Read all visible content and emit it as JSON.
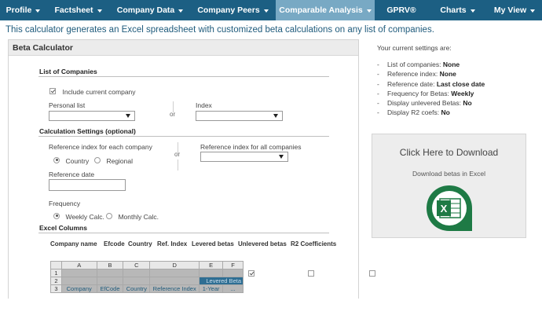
{
  "nav": [
    {
      "label": "Profile",
      "caret": true
    },
    {
      "label": "Factsheet",
      "caret": true
    },
    {
      "label": "Company Data",
      "caret": true
    },
    {
      "label": "Company Peers",
      "caret": true
    },
    {
      "label": "Comparable Analysis",
      "caret": true,
      "active": true
    },
    {
      "label": "GPRV®",
      "caret": false
    },
    {
      "label": "Charts",
      "caret": true
    },
    {
      "label": "My View",
      "caret": true
    }
  ],
  "intro": "This calculator generates an Excel spreadsheet with customized beta calculations on any list of companies.",
  "panel": {
    "title": "Beta Calculator",
    "list_section": "List of Companies",
    "include_current": "Include current company",
    "personal_list": "Personal list",
    "or": "or",
    "index": "Index",
    "calc_section": "Calculation Settings (optional)",
    "ref_each": "Reference index for each company",
    "country": "Country",
    "regional": "Regional",
    "ref_all": "Reference index for all companies",
    "ref_date": "Reference date",
    "frequency": "Frequency",
    "weekly": "Weekly Calc.",
    "monthly": "Monthly Calc.",
    "excel_section": "Excel Columns",
    "columns": [
      {
        "label": "Company name",
        "checked": true
      },
      {
        "label": "Efcode",
        "checked": true
      },
      {
        "label": "Country",
        "checked": true
      },
      {
        "label": "Ref. Index",
        "checked": true
      },
      {
        "label": "Levered betas",
        "checked": true
      },
      {
        "label": "Unlevered betas",
        "checked": false
      },
      {
        "label": "R2 Coefficients",
        "checked": false
      }
    ]
  },
  "excel_preview": {
    "col_letters": [
      "A",
      "B",
      "C",
      "D",
      "E",
      "F"
    ],
    "row_numbers": [
      "1",
      "2",
      "3"
    ],
    "row2_label": "Levered Beta",
    "row3": [
      "Company",
      "EfCode",
      "Country",
      "Reference Index",
      "1-Year",
      "..."
    ]
  },
  "settings": {
    "title": "Your current settings are:",
    "items": [
      {
        "label": "List of companies: ",
        "value": "None"
      },
      {
        "label": "Reference index: ",
        "value": "None"
      },
      {
        "label": "Reference date: ",
        "value": "Last close date"
      },
      {
        "label": "Frequency for Betas: ",
        "value": "Weekly"
      },
      {
        "label": "Display unlevered Betas: ",
        "value": "No"
      },
      {
        "label": "Display R2 coefs: ",
        "value": "No"
      }
    ]
  },
  "download": {
    "title": "Click Here to Download",
    "subtitle": "Download betas in Excel",
    "icon": "excel-icon",
    "icon_letter": "X"
  },
  "colors": {
    "nav": "#1c5f83",
    "nav_active": "#78a9c4",
    "excel_green": "#1e7a45"
  }
}
